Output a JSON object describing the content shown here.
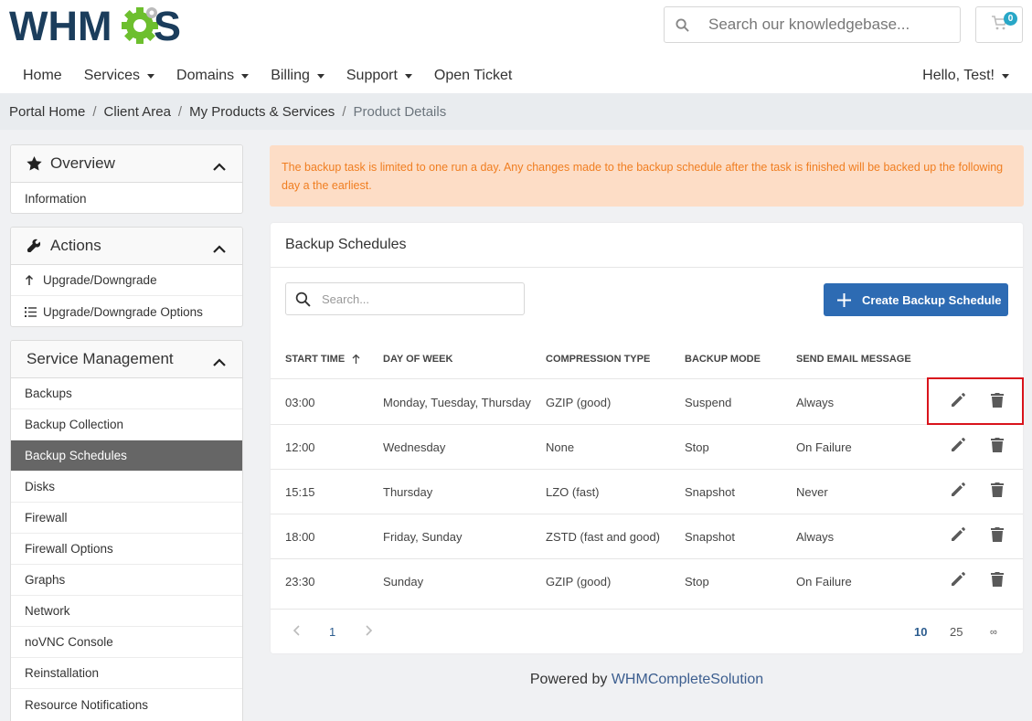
{
  "header": {
    "logo_text": "WHMCS",
    "search_placeholder": "Search our knowledgebase...",
    "cart_count": "0"
  },
  "nav": {
    "items": [
      "Home",
      "Services",
      "Domains",
      "Billing",
      "Support",
      "Open Ticket"
    ],
    "user": "Hello, Test!"
  },
  "breadcrumb": {
    "items": [
      "Portal Home",
      "Client Area",
      "My Products & Services"
    ],
    "active": "Product Details"
  },
  "sidebar": {
    "overview": {
      "title": "Overview",
      "items": [
        "Information"
      ]
    },
    "actions": {
      "title": "Actions",
      "items": [
        "Upgrade/Downgrade",
        "Upgrade/Downgrade Options"
      ]
    },
    "service": {
      "title": "Service Management",
      "items": [
        "Backups",
        "Backup Collection",
        "Backup Schedules",
        "Disks",
        "Firewall",
        "Firewall Options",
        "Graphs",
        "Network",
        "noVNC Console",
        "Reinstallation",
        "Resource Notifications"
      ],
      "active_index": 2
    }
  },
  "alert": {
    "text": "The backup task is limited to one run a day. Any changes made to the backup schedule after the task is finished will be backed up the following day a the earliest."
  },
  "card": {
    "title": "Backup Schedules",
    "search_placeholder": "Search...",
    "create_label": "Create Backup Schedule",
    "columns": [
      "START TIME",
      "DAY OF WEEK",
      "COMPRESSION TYPE",
      "BACKUP MODE",
      "SEND EMAIL MESSAGE"
    ],
    "rows": [
      [
        "03:00",
        "Monday, Tuesday, Thursday",
        "GZIP (good)",
        "Suspend",
        "Always"
      ],
      [
        "12:00",
        "Wednesday",
        "None",
        "Stop",
        "On Failure"
      ],
      [
        "15:15",
        "Thursday",
        "LZO (fast)",
        "Snapshot",
        "Never"
      ],
      [
        "18:00",
        "Friday, Sunday",
        "ZSTD (fast and good)",
        "Snapshot",
        "Always"
      ],
      [
        "23:30",
        "Sunday",
        "GZIP (good)",
        "Stop",
        "On Failure"
      ]
    ],
    "pager": {
      "current_page": "1",
      "page_sizes": [
        "10",
        "25",
        "∞"
      ]
    }
  },
  "footer": {
    "prefix": "Powered by",
    "link": "WHMCompleteSolution"
  },
  "colors": {
    "brand_dark": "#1b3d5c",
    "brand_green": "#6dbf2e",
    "primary": "#2d6bb3",
    "alert_bg": "#fdddc6",
    "alert_text": "#f07e21",
    "highlight": "#d9141c"
  }
}
